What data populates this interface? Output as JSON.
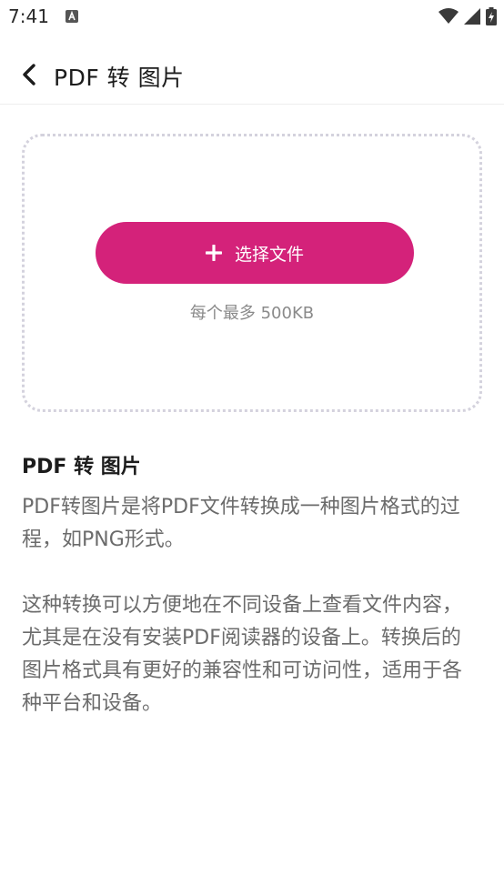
{
  "status_bar": {
    "time": "7:41",
    "icons": [
      "text-a-icon",
      "wifi-icon",
      "signal-icon",
      "battery-charging-icon"
    ]
  },
  "app_bar": {
    "back_icon": "chevron-left-icon",
    "title": "PDF 转 图片"
  },
  "upload": {
    "button_icon": "plus-icon",
    "button_label": "选择文件",
    "size_limit": "每个最多 500KB"
  },
  "info": {
    "heading": "PDF 转 图片",
    "paragraph1": "PDF转图片是将PDF文件转换成一种图片格式的过程，如PNG形式。",
    "paragraph2": "这种转换可以方便地在不同设备上查看文件内容，尤其是在没有安装PDF阅读器的设备上。转换后的图片格式具有更好的兼容性和可访问性，适用于各种平台和设备。"
  },
  "colors": {
    "accent": "#d4227a",
    "dashed_border": "#d4d2dd",
    "body_text": "#6b6b6b",
    "heading_text": "#1c1c1c"
  }
}
